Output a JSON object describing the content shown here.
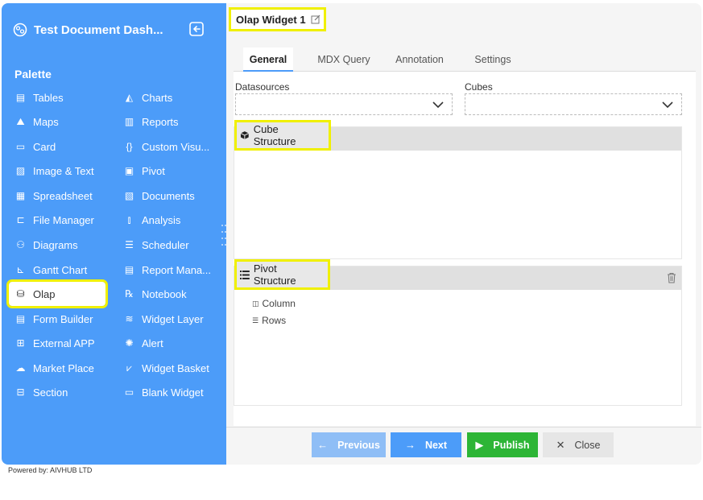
{
  "app": {
    "title": "Test Document Dash...",
    "powered_by": "Powered by: AIVHUB LTD"
  },
  "palette": {
    "title": "Palette",
    "left_items": [
      {
        "label": "Tables",
        "icon": "table-icon"
      },
      {
        "label": "Maps",
        "icon": "map-icon"
      },
      {
        "label": "Card",
        "icon": "card-icon"
      },
      {
        "label": "Image & Text",
        "icon": "image-icon"
      },
      {
        "label": "Spreadsheet",
        "icon": "spreadsheet-icon"
      },
      {
        "label": "File Manager",
        "icon": "file-manager-icon"
      },
      {
        "label": "Diagrams",
        "icon": "diagram-icon"
      },
      {
        "label": "Gantt Chart",
        "icon": "gantt-icon"
      },
      {
        "label": "Olap",
        "icon": "olap-icon"
      },
      {
        "label": "Form Builder",
        "icon": "form-icon"
      },
      {
        "label": "External APP",
        "icon": "external-app-icon"
      },
      {
        "label": "Market Place",
        "icon": "cloud-icon"
      },
      {
        "label": "Section",
        "icon": "section-icon"
      }
    ],
    "right_items": [
      {
        "label": "Charts",
        "icon": "chart-icon"
      },
      {
        "label": "Reports",
        "icon": "report-icon"
      },
      {
        "label": "Custom Visu...",
        "icon": "braces-icon"
      },
      {
        "label": "Pivot",
        "icon": "pivot-icon"
      },
      {
        "label": "Documents",
        "icon": "document-icon"
      },
      {
        "label": "Analysis",
        "icon": "analysis-icon"
      },
      {
        "label": "Scheduler",
        "icon": "scheduler-icon"
      },
      {
        "label": "Report Mana...",
        "icon": "report-manager-icon"
      },
      {
        "label": "Notebook",
        "icon": "notebook-icon"
      },
      {
        "label": "Widget Layer",
        "icon": "layers-icon"
      },
      {
        "label": "Alert",
        "icon": "alert-icon"
      },
      {
        "label": "Widget Basket",
        "icon": "basket-icon"
      },
      {
        "label": "Blank Widget",
        "icon": "blank-widget-icon"
      }
    ],
    "active": "Olap"
  },
  "widget": {
    "title": "Olap Widget 1",
    "tabs": [
      "General",
      "MDX Query",
      "Annotation",
      "Settings"
    ],
    "active_tab": "General",
    "datasources_label": "Datasources",
    "datasources_value": "",
    "cubes_label": "Cubes",
    "cubes_value": "",
    "cube_structure_title": "Cube Structure",
    "pivot_structure_title": "Pivot Structure",
    "pivot_items": [
      "Column",
      "Rows"
    ]
  },
  "buttons": {
    "previous": "Previous",
    "next": "Next",
    "publish": "Publish",
    "close": "Close"
  },
  "colors": {
    "sidebar": "#4c9cf9",
    "highlight": "#f0f000",
    "publish": "#2db536"
  }
}
